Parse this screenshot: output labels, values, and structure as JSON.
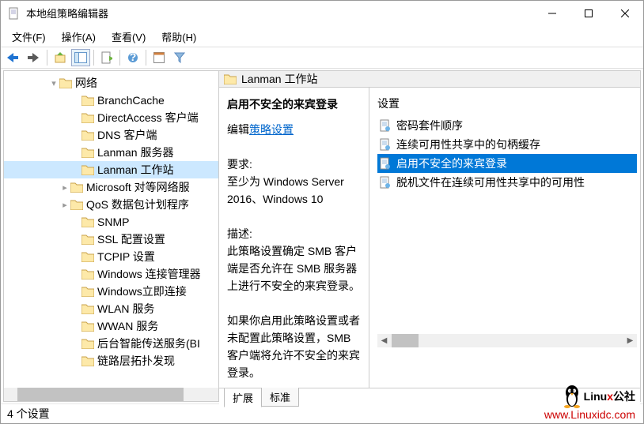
{
  "title": "本地组策略编辑器",
  "menu": {
    "file": "文件(F)",
    "action": "操作(A)",
    "view": "查看(V)",
    "help": "帮助(H)"
  },
  "tree": [
    {
      "indent": 56,
      "twisty": "▾",
      "label": "网络",
      "sel": false
    },
    {
      "indent": 84,
      "twisty": "",
      "label": "BranchCache",
      "sel": false
    },
    {
      "indent": 84,
      "twisty": "",
      "label": "DirectAccess 客户端",
      "sel": false
    },
    {
      "indent": 84,
      "twisty": "",
      "label": "DNS 客户端",
      "sel": false
    },
    {
      "indent": 84,
      "twisty": "",
      "label": "Lanman 服务器",
      "sel": false
    },
    {
      "indent": 84,
      "twisty": "",
      "label": "Lanman 工作站",
      "sel": true
    },
    {
      "indent": 70,
      "twisty": "▸",
      "label": "Microsoft 对等网络服",
      "sel": false
    },
    {
      "indent": 70,
      "twisty": "▸",
      "label": "QoS 数据包计划程序",
      "sel": false
    },
    {
      "indent": 84,
      "twisty": "",
      "label": "SNMP",
      "sel": false
    },
    {
      "indent": 84,
      "twisty": "",
      "label": "SSL 配置设置",
      "sel": false
    },
    {
      "indent": 84,
      "twisty": "",
      "label": "TCPIP 设置",
      "sel": false
    },
    {
      "indent": 84,
      "twisty": "",
      "label": "Windows 连接管理器",
      "sel": false
    },
    {
      "indent": 84,
      "twisty": "",
      "label": "Windows立即连接",
      "sel": false
    },
    {
      "indent": 84,
      "twisty": "",
      "label": "WLAN 服务",
      "sel": false
    },
    {
      "indent": 84,
      "twisty": "",
      "label": "WWAN 服务",
      "sel": false
    },
    {
      "indent": 84,
      "twisty": "",
      "label": "后台智能传送服务(BI",
      "sel": false
    },
    {
      "indent": 84,
      "twisty": "",
      "label": "链路层拓扑发现",
      "sel": false
    }
  ],
  "detail": {
    "header": "Lanman 工作站",
    "title": "启用不安全的来宾登录",
    "edit_prefix": "编辑",
    "edit_link": "策略设置",
    "req_label": "要求:",
    "req_text": "至少为 Windows Server 2016、Windows 10",
    "desc_label": "描述:",
    "desc1": "此策略设置确定 SMB 客户端是否允许在 SMB 服务器上进行不安全的来宾登录。",
    "desc2": "如果你启用此策略设置或者未配置此策略设置，SMB 客户端将允许不安全的来宾登录。"
  },
  "list": {
    "header": "设置",
    "items": [
      {
        "label": "密码套件顺序",
        "sel": false
      },
      {
        "label": "连续可用性共享中的句柄缓存",
        "sel": false
      },
      {
        "label": "启用不安全的来宾登录",
        "sel": true
      },
      {
        "label": "脱机文件在连续可用性共享中的可用性",
        "sel": false
      }
    ]
  },
  "tabs": {
    "ext": "扩展",
    "std": "标准"
  },
  "status": "4 个设置",
  "watermark": {
    "brand_black": "Linu",
    "brand_red": "x",
    "brand_suffix": "公社",
    "url": "www.Linuxidc.com"
  }
}
